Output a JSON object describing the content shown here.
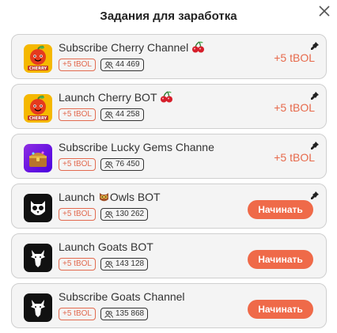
{
  "header": {
    "title": "Задания для заработка"
  },
  "tasks": [
    {
      "title": "Subscribe Cherry Channel",
      "reward_badge": "+5 tBOL",
      "count": "44 469",
      "reward_text": "+5 tBOL",
      "icon": "cherry-logo-icon"
    },
    {
      "title": "Launch Cherry BOT",
      "reward_badge": "+5 tBOL",
      "count": "44 258",
      "reward_text": "+5 tBOL",
      "icon": "cherry-logo-icon"
    },
    {
      "title": "Subscribe Lucky Gems Channe",
      "reward_badge": "+5 tBOL",
      "count": "76 450",
      "reward_text": "+5 tBOL",
      "icon": "treasure-chest-icon"
    },
    {
      "title_before": "Launch ",
      "title_after": "Owls BOT",
      "reward_badge": "+5 tBOL",
      "count": "130 262",
      "button": "Начинать",
      "icon": "owl-logo-icon"
    },
    {
      "title": "Launch Goats BOT",
      "reward_badge": "+5 tBOL",
      "count": "143 128",
      "button": "Начинать",
      "icon": "goat-logo-icon"
    },
    {
      "title": "Subscribe Goats Channel",
      "reward_badge": "+5 tBOL",
      "count": "135 868",
      "button": "Начинать",
      "icon": "goat-logo-icon"
    }
  ],
  "icons": {
    "close": "close-icon",
    "pin": "pin-icon",
    "users": "users-icon",
    "cherries": "cherries-icon",
    "owl": "owl-emoji-icon"
  },
  "colors": {
    "accent": "#ef6a49",
    "reward_text": "#e76a4c",
    "card_bg": "#f4f4f4",
    "card_border": "#cfcfcf"
  }
}
